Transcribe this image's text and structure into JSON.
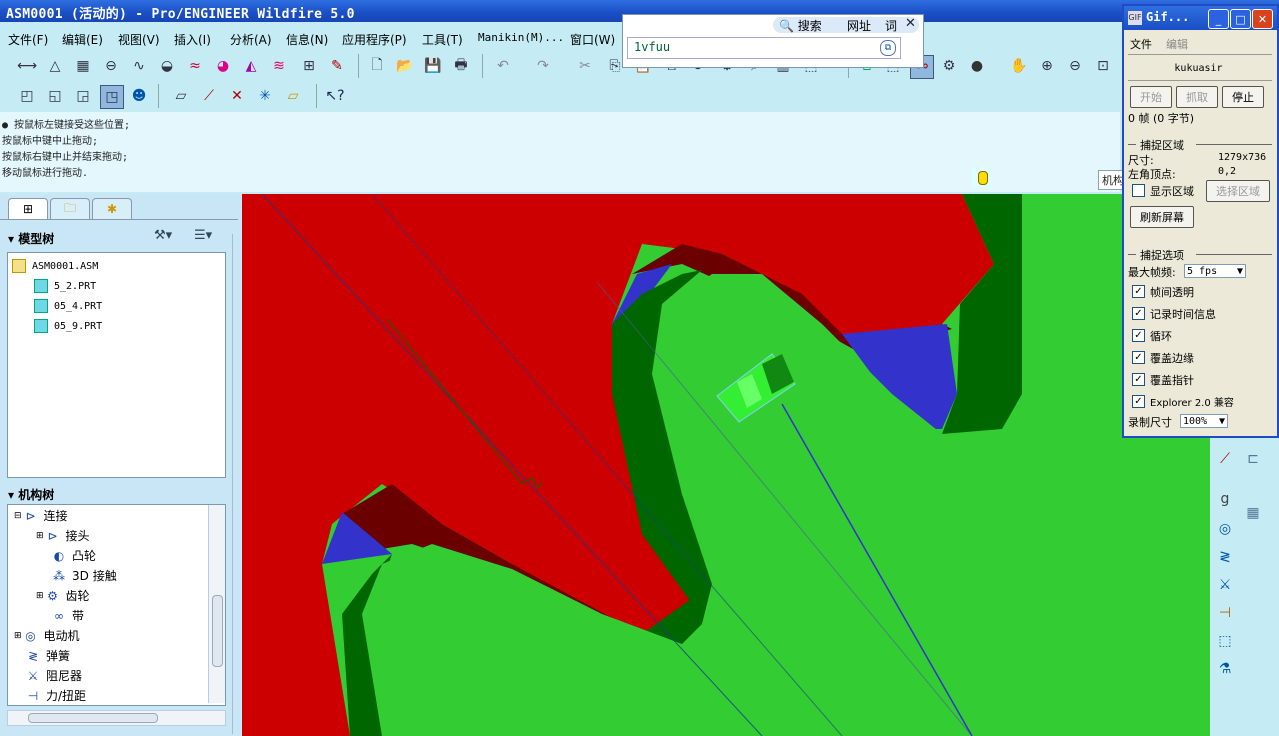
{
  "window": {
    "title": "ASM0001 (活动的) - Pro/ENGINEER Wildfire 5.0"
  },
  "menu": [
    "文件(F)",
    "编辑(E)",
    "视图(V)",
    "插入(I)",
    "分析(A)",
    "信息(N)",
    "应用程序(P)",
    "工具(T)",
    "Manikin(M)...",
    "窗口(W)"
  ],
  "messages": [
    "● 按鼠标左键接受这些位置;",
    "按鼠标中键中止拖动;",
    "按鼠标右键中止并结束拖动;",
    "移动鼠标进行拖动."
  ],
  "model_tree": {
    "header": "模型树",
    "items": [
      "ASM0001.ASM",
      "5_2.PRT",
      "05_4.PRT",
      "05_9.PRT"
    ]
  },
  "mech_tree": {
    "header": "机构树",
    "items": [
      {
        "label": "连接",
        "level": 0,
        "icon": "connection-icon"
      },
      {
        "label": "接头",
        "level": 1,
        "icon": "joint-icon"
      },
      {
        "label": "凸轮",
        "level": 1,
        "icon": "cam-icon"
      },
      {
        "label": "3D 接触",
        "level": 1,
        "icon": "contact-3d-icon"
      },
      {
        "label": "齿轮",
        "level": 1,
        "icon": "gear-icon"
      },
      {
        "label": "带",
        "level": 1,
        "icon": "belt-icon"
      },
      {
        "label": "电动机",
        "level": 0,
        "icon": "motor-icon"
      },
      {
        "label": "弹簧",
        "level": 0,
        "icon": "spring-icon"
      },
      {
        "label": "阻尼器",
        "level": 0,
        "icon": "damper-icon"
      },
      {
        "label": "力/扭距",
        "level": 0,
        "icon": "force-torque-icon"
      }
    ]
  },
  "popup": {
    "search": "搜索",
    "url": "网址",
    "word": "词",
    "input": "1vfuu"
  },
  "view_label": "机构",
  "gif": {
    "title": "Gif...",
    "menu_file": "文件",
    "menu_edit": "编辑",
    "author": "kukuasir",
    "start": "开始",
    "grab": "抓取",
    "stop": "停止",
    "frames": "0 帧 (0 字节)",
    "capture_area": "捕捉区域",
    "size_label": "尺寸:",
    "size_value": "1279x736",
    "corner_label": "左角顶点:",
    "corner_value": "0,2",
    "show_area": "显示区域",
    "select_area": "选择区域",
    "refresh": "刷新屏幕",
    "capture_options": "捕捉选项",
    "max_fps_label": "最大帧频:",
    "max_fps_value": "5 fps",
    "opt_transparent": "帧间透明",
    "opt_timeinfo": "记录时间信息",
    "opt_loop": "循环",
    "opt_border": "覆盖边缘",
    "opt_pointer": "覆盖指针",
    "opt_explorer": "Explorer 2.0 兼容",
    "record_size_label": "录制尺寸",
    "record_size_value": "100%"
  }
}
